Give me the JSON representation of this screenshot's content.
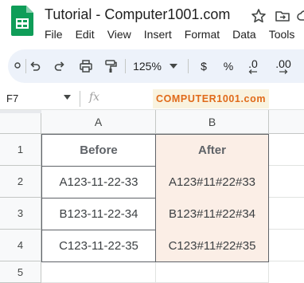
{
  "app": {
    "title": "Tutorial - Computer1001.com"
  },
  "menu": [
    "File",
    "Edit",
    "View",
    "Insert",
    "Format",
    "Data",
    "Tools"
  ],
  "toolbar": {
    "zoom": "125%",
    "currency": "$",
    "percent": "%",
    "decrease_decimal": ".0",
    "increase_decimal": ".00"
  },
  "formula_bar": {
    "cell_ref": "F7",
    "fx": "fx",
    "watermark": "COMPUTER1001.com"
  },
  "sheet": {
    "columns": [
      "A",
      "B"
    ],
    "rows": [
      "1",
      "2",
      "3",
      "4",
      "5"
    ],
    "cells": [
      [
        "Before",
        "After"
      ],
      [
        "A123-11-22-33",
        "A123#11#22#33"
      ],
      [
        "B123-11-22-34",
        "B123#11#22#34"
      ],
      [
        "C123-11-22-35",
        "C123#11#22#35"
      ]
    ]
  },
  "colors": {
    "header_fill": "#fbeee6",
    "toolbar_bg": "#edf2fa",
    "sheets_green": "#0f9d58"
  }
}
